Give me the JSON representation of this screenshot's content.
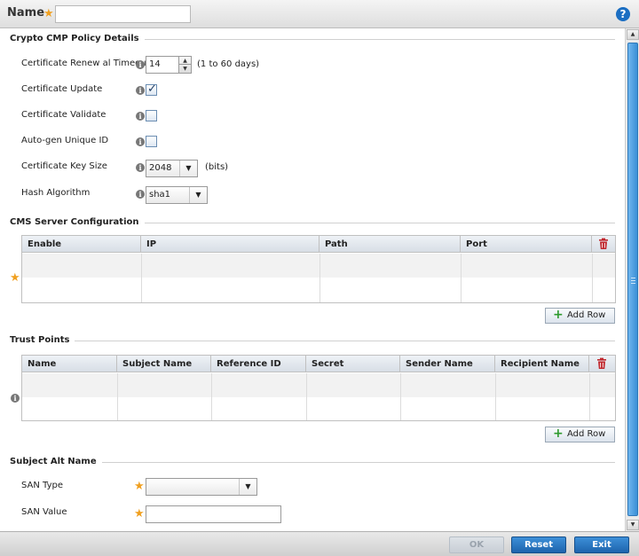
{
  "header": {
    "name_label": "Name",
    "name_value": ""
  },
  "crypto": {
    "title": "Crypto CMP Policy Details",
    "renewal_label": "Certificate Renew al Timeout",
    "renewal_value": "14",
    "renewal_hint": "(1 to 60 days)",
    "update_label": "Certificate Update",
    "update_checked": true,
    "validate_label": "Certificate Validate",
    "validate_checked": false,
    "autogen_label": "Auto-gen Unique ID",
    "autogen_checked": false,
    "keysize_label": "Certificate Key Size",
    "keysize_value": "2048",
    "keysize_unit": "(bits)",
    "hash_label": "Hash Algorithm",
    "hash_value": "sha1"
  },
  "cms": {
    "title": "CMS Server Configuration",
    "columns": [
      "Enable",
      "IP",
      "Path",
      "Port"
    ],
    "rows": [],
    "add_row_label": "Add Row"
  },
  "trust": {
    "title": "Trust Points",
    "columns": [
      "Name",
      "Subject Name",
      "Reference ID",
      "Secret",
      "Sender Name",
      "Recipient Name"
    ],
    "rows": [],
    "add_row_label": "Add Row"
  },
  "san": {
    "title": "Subject Alt Name",
    "type_label": "SAN Type",
    "type_value": "",
    "value_label": "SAN Value",
    "value_value": ""
  },
  "footer": {
    "ok_label": "OK",
    "reset_label": "Reset",
    "exit_label": "Exit"
  },
  "colors": {
    "accent": "#1d64ad",
    "required_star": "#f0a020",
    "trash": "#c0272d",
    "add": "#2e9a2e"
  }
}
